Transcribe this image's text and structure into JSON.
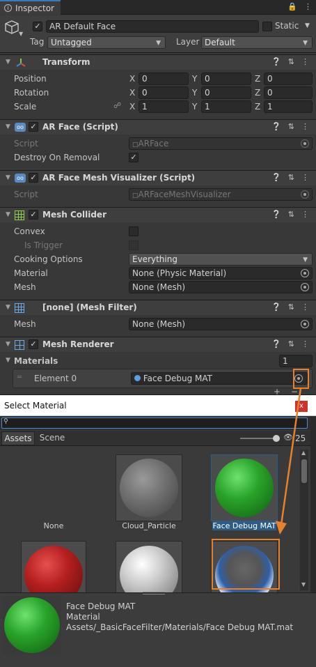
{
  "tab": {
    "title": "Inspector"
  },
  "object": {
    "name": "AR Default Face",
    "static_label": "Static",
    "tag_label": "Tag",
    "tag_value": "Untagged",
    "layer_label": "Layer",
    "layer_value": "Default"
  },
  "transform": {
    "title": "Transform",
    "rows": [
      {
        "label": "Position",
        "x": "0",
        "y": "0",
        "z": "0"
      },
      {
        "label": "Rotation",
        "x": "0",
        "y": "0",
        "z": "0"
      },
      {
        "label": "Scale",
        "x": "1",
        "y": "1",
        "z": "1"
      }
    ],
    "axes": [
      "X",
      "Y",
      "Z"
    ]
  },
  "arface": {
    "title": "AR Face (Script)",
    "script_label": "Script",
    "script_value": "ARFace",
    "destroy_label": "Destroy On Removal"
  },
  "arvis": {
    "title": "AR Face Mesh Visualizer (Script)",
    "script_label": "Script",
    "script_value": "ARFaceMeshVisualizer"
  },
  "collider": {
    "title": "Mesh Collider",
    "convex_label": "Convex",
    "trigger_label": "Is Trigger",
    "cooking_label": "Cooking Options",
    "cooking_value": "Everything",
    "material_label": "Material",
    "material_value": "None (Physic Material)",
    "mesh_label": "Mesh",
    "mesh_value": "None (Mesh)"
  },
  "filter": {
    "title": "[none] (Mesh Filter)",
    "mesh_label": "Mesh",
    "mesh_value": "None (Mesh)"
  },
  "renderer": {
    "title": "Mesh Renderer",
    "materials_label": "Materials",
    "materials_count": "1",
    "element_label": "Element 0",
    "element_value": "Face Debug MAT"
  },
  "dialog": {
    "title": "Select Material",
    "close": "x",
    "tabs": [
      "Assets",
      "Scene"
    ],
    "count": "25",
    "items": [
      {
        "name": "None"
      },
      {
        "name": "Cloud_Particle"
      },
      {
        "name": "Face Debug MAT"
      }
    ],
    "preview": {
      "name": "Face Debug MAT",
      "type": "Material",
      "path": "Assets/_BasicFaceFilter/Materials/Face Debug MAT.mat"
    }
  },
  "colors": {
    "accent": "#3a79bb",
    "highlight": "#e8822a",
    "selected": "#2c5d87"
  }
}
